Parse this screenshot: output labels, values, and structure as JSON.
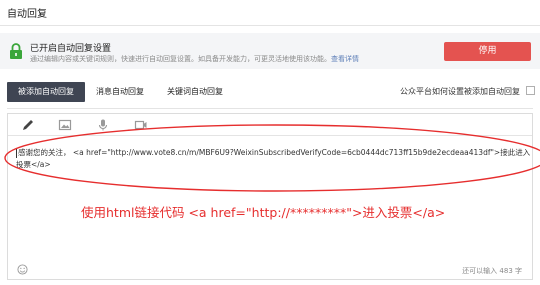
{
  "page": {
    "title": "自动回复"
  },
  "notice": {
    "icon": "lock-icon",
    "title": "已开启自动回复设置",
    "desc": "通过编辑内容或关键词规则，快速进行自动回复设置。如具备开发能力，可更灵活地使用该功能。",
    "link": "查看详情",
    "disable_label": "停用",
    "accent": "#e45350"
  },
  "tabs": {
    "items": [
      {
        "label": "被添加自动回复",
        "active": true
      },
      {
        "label": "消息自动回复",
        "active": false
      },
      {
        "label": "关键词自动回复",
        "active": false
      }
    ],
    "hint": "公众平台如何设置被添加自动回复"
  },
  "editor": {
    "tools": [
      "pen-icon",
      "image-icon",
      "microphone-icon",
      "video-icon"
    ],
    "text": "感谢您的关注， <a href=\"http://www.vote8.cn/m/MBF6U9?WeixinSubscribedVerifyCode=6cb0444dc713ff15b9de2ecdeaa413df\">接此进入投票</a>",
    "annotation": "使用html链接代码 <a href=\"http://*********\">进入投票</a>",
    "annotation_color": "#e62e2e",
    "char_count": "还可以输入 483 字"
  }
}
